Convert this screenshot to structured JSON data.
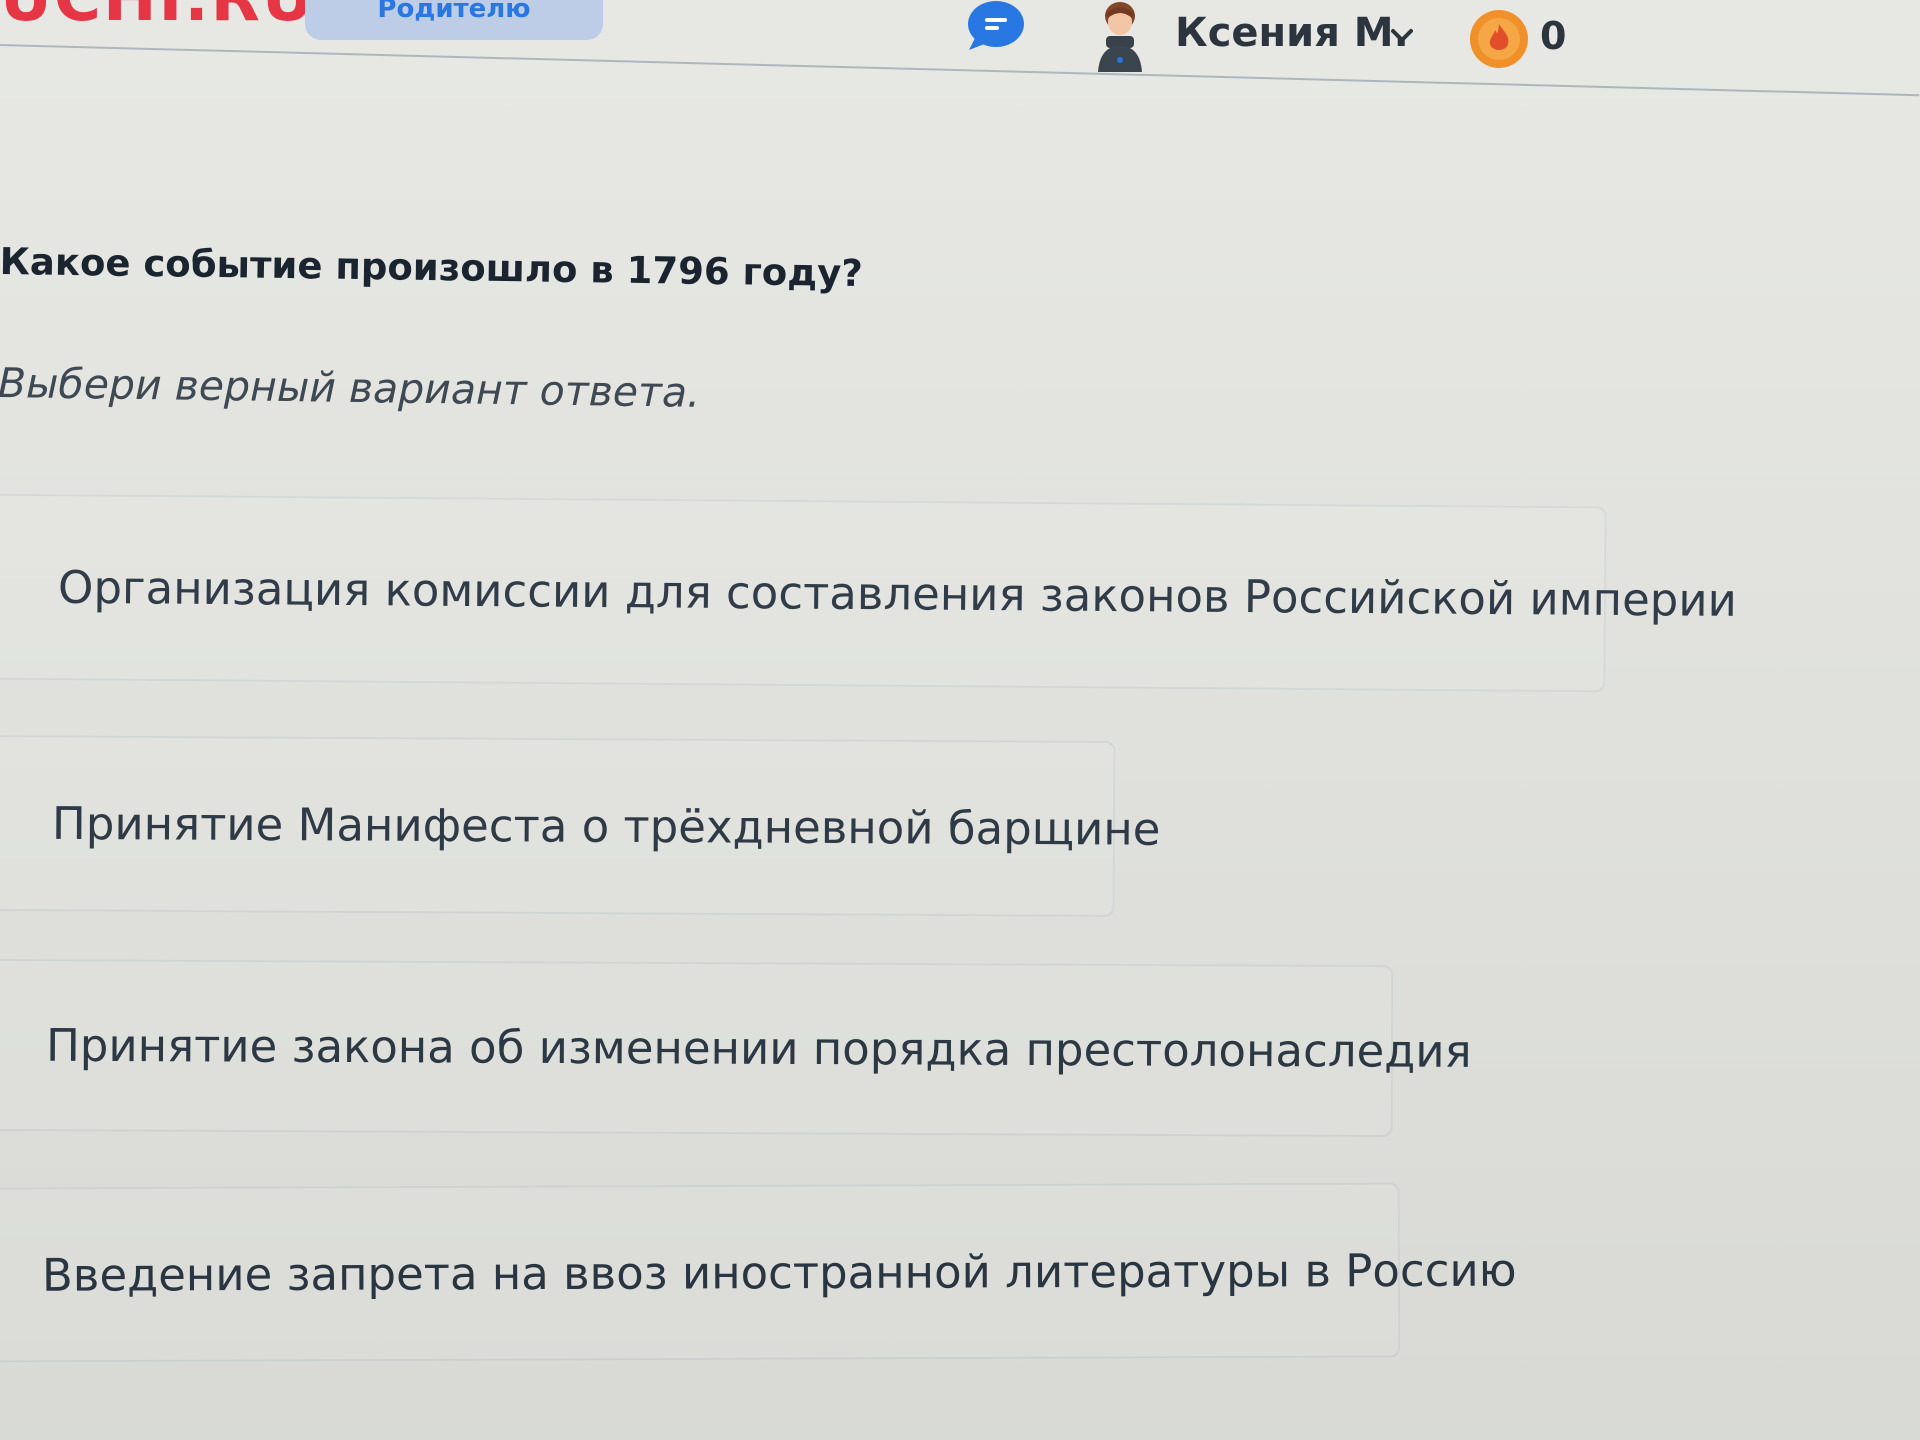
{
  "header": {
    "logo_text": "UCHI.RU",
    "parent_button_label": "Родителю",
    "chat_icon": "chat-bubble-icon",
    "user_name": "Ксения М.",
    "user_menu_icon": "chevron-down-icon",
    "coins_icon": "coin-icon",
    "coins_count": "0"
  },
  "quiz": {
    "question": "Какое событие произошло в 1796 году?",
    "instruction": "Выбери верный вариант ответа.",
    "options": [
      {
        "label": "Организация комиссии для составления законов Российской империи"
      },
      {
        "label": "Принятие Манифеста о трёхдневной барщине"
      },
      {
        "label": "Принятие закона об изменении порядка престолонаследия"
      },
      {
        "label": "Введение запрета на ввоз иностранной литературы в Россию"
      }
    ]
  },
  "colors": {
    "background": "#e6e7e2",
    "brand_red": "#e52a3a",
    "accent_blue": "#1b6fe0",
    "coin_orange": "#f08a1c"
  }
}
